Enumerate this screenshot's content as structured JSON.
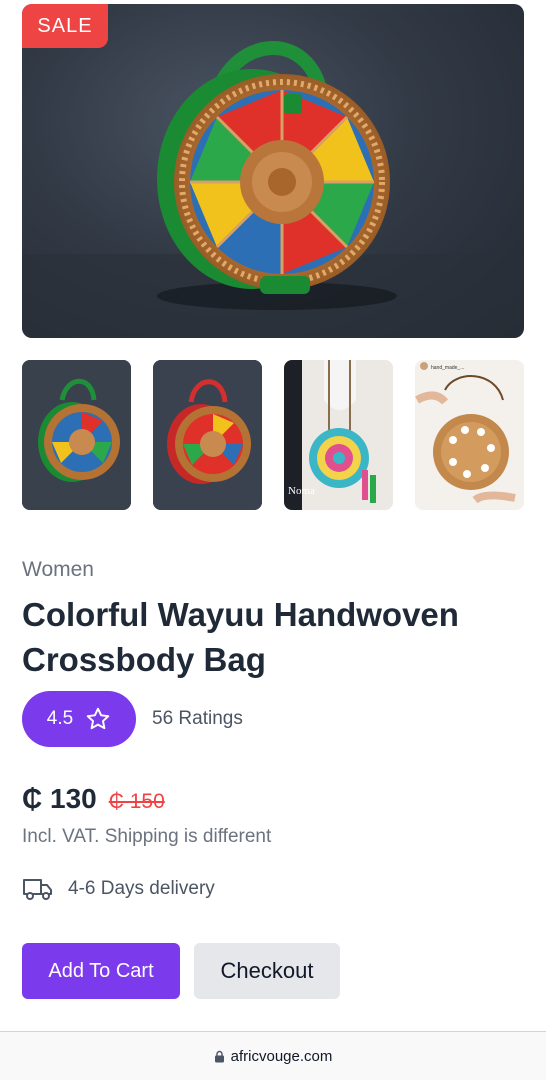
{
  "product": {
    "badge": "SALE",
    "category": "Women",
    "title": "Colorful Wayuu Handwoven Crossbody Bag",
    "rating": "4.5",
    "ratings_count": "56 Ratings",
    "price": "₵ 130",
    "old_price": "₵ 150",
    "vat_note": "Incl. VAT. Shipping is different",
    "delivery": "4-6 Days delivery"
  },
  "gallery": {
    "thumbs": [
      {
        "icon": "green-rattan-bag"
      },
      {
        "icon": "red-rattan-bag"
      },
      {
        "icon": "wayuu-crossbody-worn",
        "caption": "Noma"
      },
      {
        "icon": "rattan-bag-held",
        "caption": "hand_made_..."
      }
    ]
  },
  "actions": {
    "add_to_cart": "Add To Cart",
    "checkout": "Checkout"
  },
  "browser": {
    "url": "africvouge.com",
    "icon": "lock-icon"
  },
  "colors": {
    "accent": "#7c3aed",
    "sale": "#ef4444"
  }
}
